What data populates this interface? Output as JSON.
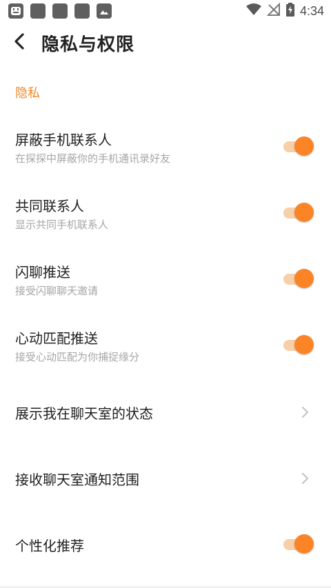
{
  "status_bar": {
    "time": "4:34",
    "left_icons": [
      "app-notification-icon",
      "app-icon",
      "app-icon",
      "app-icon",
      "image-icon"
    ],
    "right_icons": [
      "wifi-icon",
      "no-signal-icon",
      "battery-charging-icon"
    ]
  },
  "header": {
    "title": "隐私与权限",
    "back_icon": "chevron-left-icon"
  },
  "section": {
    "title": "隐私"
  },
  "rows": [
    {
      "title": "屏蔽手机联系人",
      "subtitle": "在探探中屏蔽你的手机通讯录好友",
      "control": "toggle",
      "on": true
    },
    {
      "title": "共同联系人",
      "subtitle": "显示共同手机联系人",
      "control": "toggle",
      "on": true
    },
    {
      "title": "闪聊推送",
      "subtitle": "接受闪聊聊天邀请",
      "control": "toggle",
      "on": true
    },
    {
      "title": "心动匹配推送",
      "subtitle": "接受心动匹配为你捕捉缘分",
      "control": "toggle",
      "on": true
    },
    {
      "title": "展示我在聊天室的状态",
      "subtitle": "",
      "control": "chevron"
    },
    {
      "title": "接收聊天室通知范围",
      "subtitle": "",
      "control": "chevron"
    },
    {
      "title": "个性化推荐",
      "subtitle": "",
      "control": "toggle",
      "on": true
    }
  ],
  "colors": {
    "accent": "#f08a2b",
    "toggle_knob": "#fb8427",
    "toggle_track": "#f7cfa9"
  }
}
